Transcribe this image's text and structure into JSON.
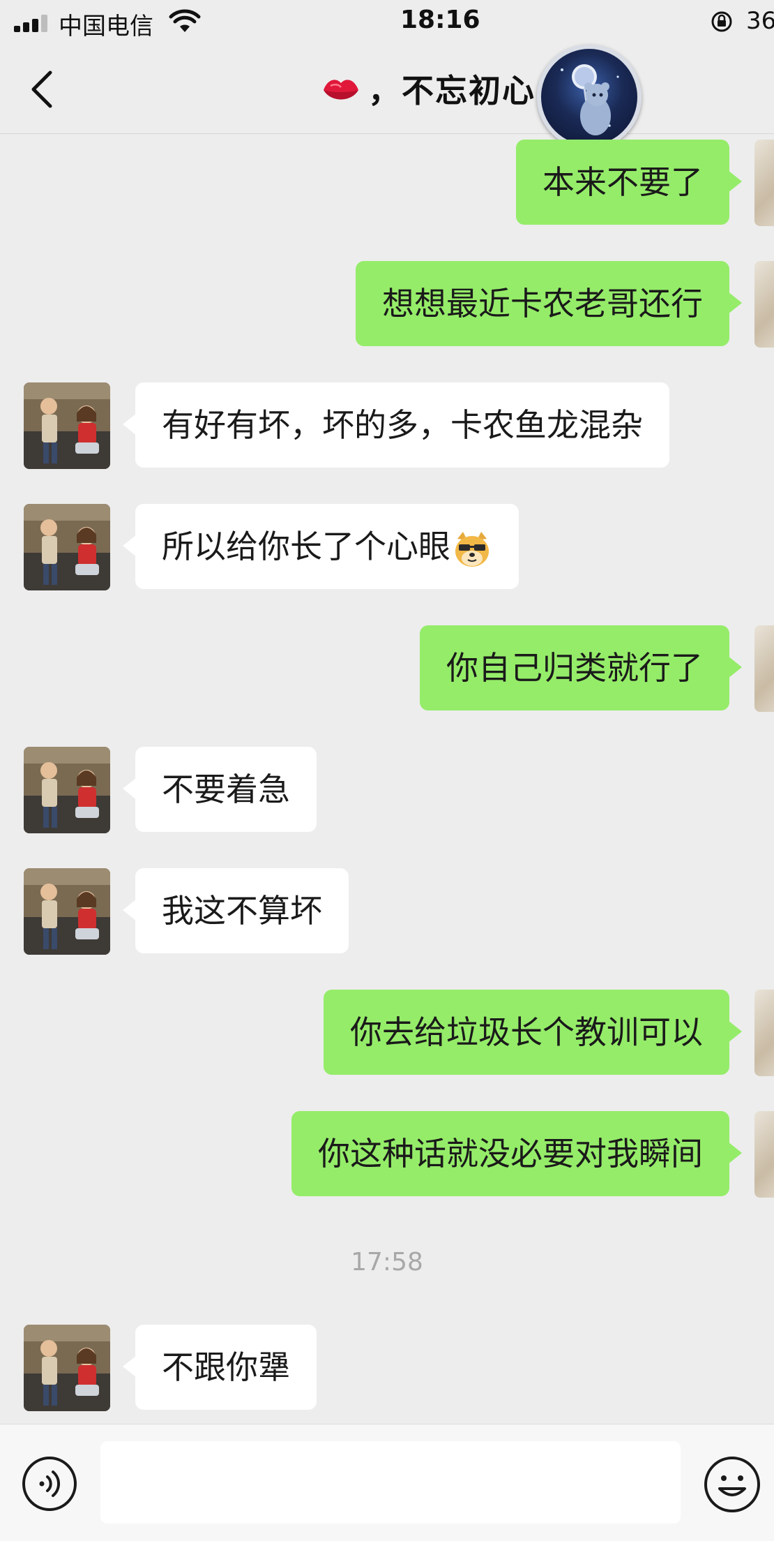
{
  "status_bar": {
    "carrier": "中国电信",
    "time": "18:16",
    "battery": "36"
  },
  "header": {
    "title": "，不忘初心",
    "title_emoji_icon": "kiss-lips-icon",
    "avatar_icon": "bear-astronaut-avatar"
  },
  "messages": [
    {
      "side": "right",
      "text": "本来不要了"
    },
    {
      "side": "right",
      "text": "想想最近卡农老哥还行"
    },
    {
      "side": "left",
      "text": "有好有坏，坏的多，卡农鱼龙混杂"
    },
    {
      "side": "left",
      "text": "所以给你长了个心眼",
      "emoji": "doge-sunglasses-emoji"
    },
    {
      "side": "right",
      "text": "你自己归类就行了"
    },
    {
      "side": "left",
      "text": "不要着急"
    },
    {
      "side": "left",
      "text": "我这不算坏"
    },
    {
      "side": "right",
      "text": "你去给垃圾长个教训可以"
    },
    {
      "side": "right",
      "text": "你这种话就没必要对我瞬间"
    },
    {
      "side": "time",
      "text": "17:58"
    },
    {
      "side": "left",
      "text": "不跟你犟"
    }
  ],
  "input_bar": {
    "placeholder": "",
    "voice_icon": "voice-icon",
    "emoji_icon": "smiley-icon"
  },
  "colors": {
    "background": "#ededed",
    "sent_bubble": "#95ec69",
    "received_bubble": "#ffffff",
    "timestamp": "#a8a8a8"
  }
}
